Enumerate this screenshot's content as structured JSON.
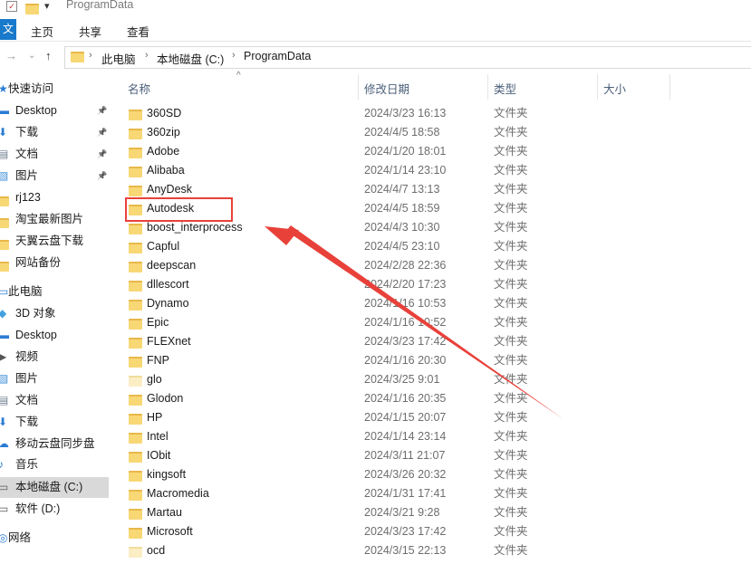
{
  "window": {
    "title": "ProgramData",
    "quick_access_toolbar": [
      "✓",
      "▾"
    ]
  },
  "ribbon": {
    "file_tab": "文件",
    "tabs": [
      "主页",
      "共享",
      "查看"
    ]
  },
  "address_bar": {
    "crumbs": [
      "此电脑",
      "本地磁盘 (C:)",
      "ProgramData"
    ]
  },
  "sidebar": {
    "items": [
      {
        "label": "快速访问",
        "icon": "star-icon",
        "section": true
      },
      {
        "label": "Desktop",
        "icon": "desktop-icon",
        "pinned": true
      },
      {
        "label": "下载",
        "icon": "download-icon",
        "pinned": true
      },
      {
        "label": "文档",
        "icon": "document-icon",
        "pinned": true
      },
      {
        "label": "图片",
        "icon": "picture-icon",
        "pinned": true
      },
      {
        "label": "rj123",
        "icon": "folder-icon"
      },
      {
        "label": "淘宝最新图片",
        "icon": "folder-icon"
      },
      {
        "label": "天翼云盘下载",
        "icon": "folder-icon"
      },
      {
        "label": "网站备份",
        "icon": "folder-icon"
      },
      {
        "label": "此电脑",
        "icon": "computer-icon",
        "section": true
      },
      {
        "label": "3D 对象",
        "icon": "cube-icon"
      },
      {
        "label": "Desktop",
        "icon": "desktop-icon"
      },
      {
        "label": "视频",
        "icon": "video-icon"
      },
      {
        "label": "图片",
        "icon": "picture-icon"
      },
      {
        "label": "文档",
        "icon": "document-icon"
      },
      {
        "label": "下载",
        "icon": "download-icon"
      },
      {
        "label": "移动云盘同步盘",
        "icon": "cloud-drive-icon"
      },
      {
        "label": "音乐",
        "icon": "music-icon"
      },
      {
        "label": "本地磁盘 (C:)",
        "icon": "drive-icon",
        "selected": true
      },
      {
        "label": "软件 (D:)",
        "icon": "drive-icon"
      },
      {
        "label": "网络",
        "icon": "network-icon",
        "section": true
      }
    ]
  },
  "columns": {
    "name": "名称",
    "date": "修改日期",
    "type": "类型",
    "size": "大小"
  },
  "files": [
    {
      "name": "360SD",
      "date": "2024/3/23 16:13",
      "type": "文件夹"
    },
    {
      "name": "360zip",
      "date": "2024/4/5 18:58",
      "type": "文件夹"
    },
    {
      "name": "Adobe",
      "date": "2024/1/20 18:01",
      "type": "文件夹"
    },
    {
      "name": "Alibaba",
      "date": "2024/1/14 23:10",
      "type": "文件夹"
    },
    {
      "name": "AnyDesk",
      "date": "2024/4/7 13:13",
      "type": "文件夹"
    },
    {
      "name": "Autodesk",
      "date": "2024/4/5 18:59",
      "type": "文件夹",
      "highlighted": true
    },
    {
      "name": "boost_interprocess",
      "date": "2024/4/3 10:30",
      "type": "文件夹"
    },
    {
      "name": "Capful",
      "date": "2024/4/5 23:10",
      "type": "文件夹"
    },
    {
      "name": "deepscan",
      "date": "2024/2/28 22:36",
      "type": "文件夹"
    },
    {
      "name": "dllescort",
      "date": "2024/2/20 17:23",
      "type": "文件夹"
    },
    {
      "name": "Dynamo",
      "date": "2024/1/16 10:53",
      "type": "文件夹"
    },
    {
      "name": "Epic",
      "date": "2024/1/16 10:52",
      "type": "文件夹"
    },
    {
      "name": "FLEXnet",
      "date": "2024/3/23 17:42",
      "type": "文件夹"
    },
    {
      "name": "FNP",
      "date": "2024/1/16 20:30",
      "type": "文件夹"
    },
    {
      "name": "glo",
      "date": "2024/3/25 9:01",
      "type": "文件夹",
      "pale": true
    },
    {
      "name": "Glodon",
      "date": "2024/1/16 20:35",
      "type": "文件夹"
    },
    {
      "name": "HP",
      "date": "2024/1/15 20:07",
      "type": "文件夹"
    },
    {
      "name": "Intel",
      "date": "2024/1/14 23:14",
      "type": "文件夹"
    },
    {
      "name": "IObit",
      "date": "2024/3/11 21:07",
      "type": "文件夹"
    },
    {
      "name": "kingsoft",
      "date": "2024/3/26 20:32",
      "type": "文件夹"
    },
    {
      "name": "Macromedia",
      "date": "2024/1/31 17:41",
      "type": "文件夹"
    },
    {
      "name": "Martau",
      "date": "2024/3/21 9:28",
      "type": "文件夹"
    },
    {
      "name": "Microsoft",
      "date": "2024/3/23 17:42",
      "type": "文件夹"
    },
    {
      "name": "ocd",
      "date": "2024/3/15 22:13",
      "type": "文件夹",
      "pale": true
    }
  ],
  "colors": {
    "highlight_box": "#e8413a",
    "arrow": "#e8413a",
    "file_tab": "#1979ca",
    "selected_bg": "#d9d9d9"
  }
}
